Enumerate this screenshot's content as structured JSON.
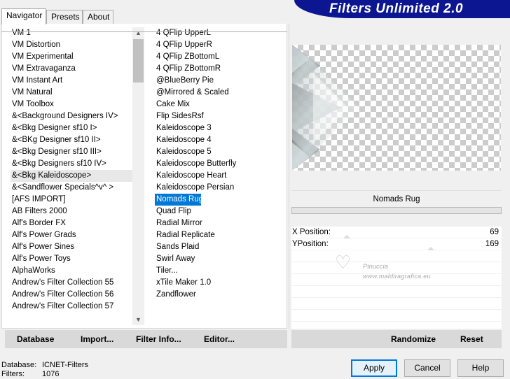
{
  "tabs": [
    {
      "label": "Navigator"
    },
    {
      "label": "Presets"
    },
    {
      "label": "About"
    }
  ],
  "banner": {
    "title": "Filters Unlimited 2.0"
  },
  "categories": [
    "VM 1",
    "VM Distortion",
    "VM Experimental",
    "VM Extravaganza",
    "VM Instant Art",
    "VM Natural",
    "VM Toolbox",
    "&<Background Designers IV>",
    "&<Bkg Designer sf10 I>",
    "&<BKg Designer sf10 II>",
    "&<Bkg Designer sf10 III>",
    "&<Bkg Designers sf10 IV>",
    "&<Bkg Kaleidoscope>",
    "&<Sandflower Specials^v^ >",
    "[AFS IMPORT]",
    "AB Filters 2000",
    "Alf's Border FX",
    "Alf's Power Grads",
    "Alf's Power Sines",
    "Alf's Power Toys",
    "AlphaWorks",
    "Andrew's Filter Collection 55",
    "Andrew's Filter Collection 56",
    "Andrew's Filter Collection 57"
  ],
  "selected_category": "&<Bkg Kaleidoscope>",
  "filters": [
    "4 QFlip UpperL",
    "4 QFlip UpperR",
    "4 QFlip ZBottomL",
    "4 QFlip ZBottomR",
    "@BlueBerry Pie",
    "@Mirrored & Scaled",
    "Cake Mix",
    "Flip SidesRsf",
    "Kaleidoscope 3",
    "Kaleidoscope 4",
    "Kaleidoscope 5",
    "Kaleidoscope Butterfly",
    "Kaleidoscope Heart",
    "Kaleidoscope Persian",
    "Nomads Rug",
    "Quad Flip",
    "Radial Mirror",
    "Radial Replicate",
    "Sands Plaid",
    "Swirl Away",
    "Tiler...",
    "xTile Maker 1.0",
    "Zandflower"
  ],
  "selected_filter": "Nomads Rug",
  "filter_name": "Nomads Rug",
  "params": [
    {
      "label": "X Position:",
      "value": "69"
    },
    {
      "label": "YPosition:",
      "value": "169"
    }
  ],
  "watermark": {
    "name": "Pinuccia",
    "url": "www.maldiragrafica.eu"
  },
  "strip_left": {
    "database": "Database",
    "import": "Import...",
    "filter_info": "Filter Info...",
    "editor": "Editor..."
  },
  "strip_right": {
    "randomize": "Randomize",
    "reset": "Reset"
  },
  "status": {
    "database_label": "Database:",
    "database_value": "ICNET-Filters",
    "filters_label": "Filters:",
    "filters_value": "1076"
  },
  "buttons": {
    "apply": "Apply",
    "cancel": "Cancel",
    "help": "Help"
  },
  "colors": {
    "banner": "#0b1690",
    "selection": "#0078d7"
  }
}
